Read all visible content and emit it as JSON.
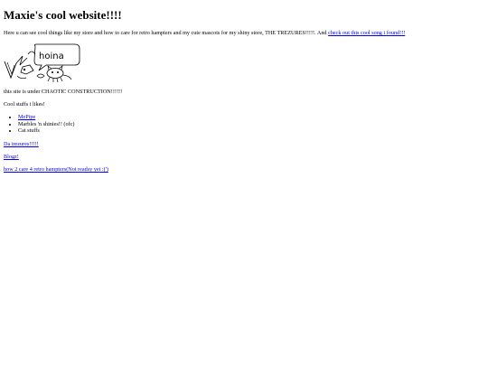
{
  "page": {
    "title": "Maxie's cool website!!!!",
    "intro_text": "Here u can see cool things like my store and how to care for retro hampters and my cute mascots for my shiny store, THE TREZURES!!!!!. And ",
    "intro_link": "check out this cool song i found!!!",
    "construction_text": "this site is under CHAOTIC CONSTRUCTION!!!!!!",
    "likes_heading": "Cool stuffs i likes!",
    "likes": [
      {
        "label": "MePipe",
        "is_link": true
      },
      {
        "label": "Marbles 'n shinies!! (ofc)",
        "is_link": false
      },
      {
        "label": "Cat stuffs",
        "is_link": false
      }
    ],
    "links": {
      "trezures": "Da trezures!!!!!",
      "blogz": "Blogz!",
      "hampters": "how 2 care 4 retro hampters(Not readsy yet :(')"
    },
    "drawing": {
      "speech_text": "hoina",
      "description_icon": "mascot-doodle-icon"
    },
    "colors": {
      "link": "#0000ee",
      "text": "#000000",
      "background": "#ffffff"
    }
  }
}
